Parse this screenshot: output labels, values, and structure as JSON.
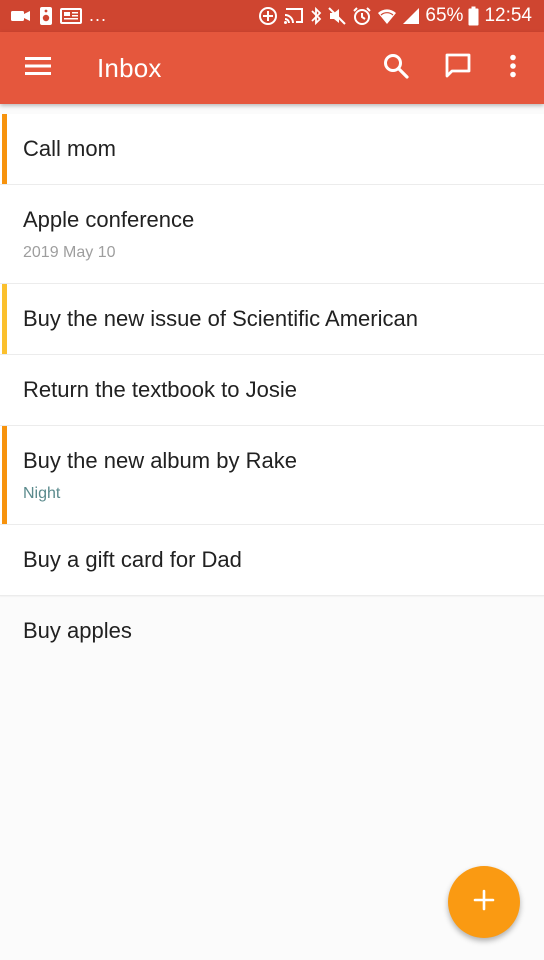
{
  "status_bar": {
    "battery": "65%",
    "time": "12:54",
    "more": "...",
    "icons": [
      "video-icon",
      "speaker-icon",
      "news-icon",
      "add-circle-icon",
      "cast-icon",
      "bluetooth-icon",
      "mute-icon",
      "alarm-icon",
      "wifi-icon",
      "signal-icon",
      "battery-icon"
    ]
  },
  "app_bar": {
    "title": "Inbox",
    "icons": [
      "menu-icon",
      "search-icon",
      "feedback-icon",
      "more-vertical-icon"
    ]
  },
  "tasks": [
    {
      "title": "Call mom",
      "subtitle": "",
      "priority_color": "#f7930d"
    },
    {
      "title": "Apple conference",
      "subtitle": "2019 May 10",
      "priority_color": ""
    },
    {
      "title": "Buy the new issue of Scientific American",
      "subtitle": "",
      "priority_color": "#fbc02d"
    },
    {
      "title": "Return the textbook to Josie",
      "subtitle": "",
      "priority_color": ""
    },
    {
      "title": "Buy the new album by Rake",
      "subtitle": "Night",
      "priority_color": "#f7930d"
    },
    {
      "title": "Buy a gift card for Dad",
      "subtitle": "",
      "priority_color": ""
    },
    {
      "title": "Buy apples",
      "subtitle": "",
      "priority_color": ""
    }
  ],
  "fab": {
    "icon": "add-icon"
  },
  "colors": {
    "status_bar": "#cf4530",
    "app_bar": "#e5573d",
    "fab": "#fa9a12",
    "label_text": "#5a8a8c"
  }
}
